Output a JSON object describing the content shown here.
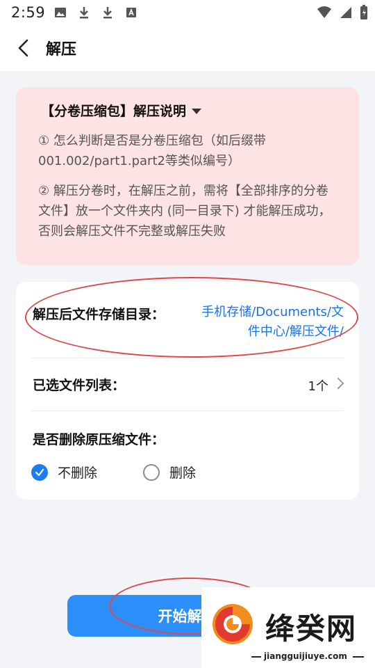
{
  "status_bar": {
    "time": "2:59"
  },
  "header": {
    "title": "解压"
  },
  "notice": {
    "title": "【分卷压缩包】解压说明",
    "item1": "① 怎么判断是否是分卷压缩包（如后缀带001.002/part1.part2等类似编号）",
    "item2": "② 解压分卷时，在解压之前，需将【全部排序的分卷文件】放一个文件夹内 (同一目录下) 才能解压成功，否则会解压文件不完整或解压失败"
  },
  "settings": {
    "dir_label": "解压后文件存储目录：",
    "dir_value": "手机存储/Documents/文件中心/解压文件/",
    "files_label": "已选文件列表：",
    "files_count": "1个",
    "delete_label": "是否删除原压缩文件：",
    "options": [
      "不删除",
      "删除"
    ],
    "selected_option": "不删除"
  },
  "start_button": {
    "label": "开始解压"
  },
  "watermark": {
    "name": "绛癸网",
    "url": "jiangguijiuye.com"
  },
  "colors": {
    "accent": "#2c8ef8",
    "link": "#1a73e8",
    "notice_bg": "#fde3e3",
    "annotation": "#e0474a"
  }
}
